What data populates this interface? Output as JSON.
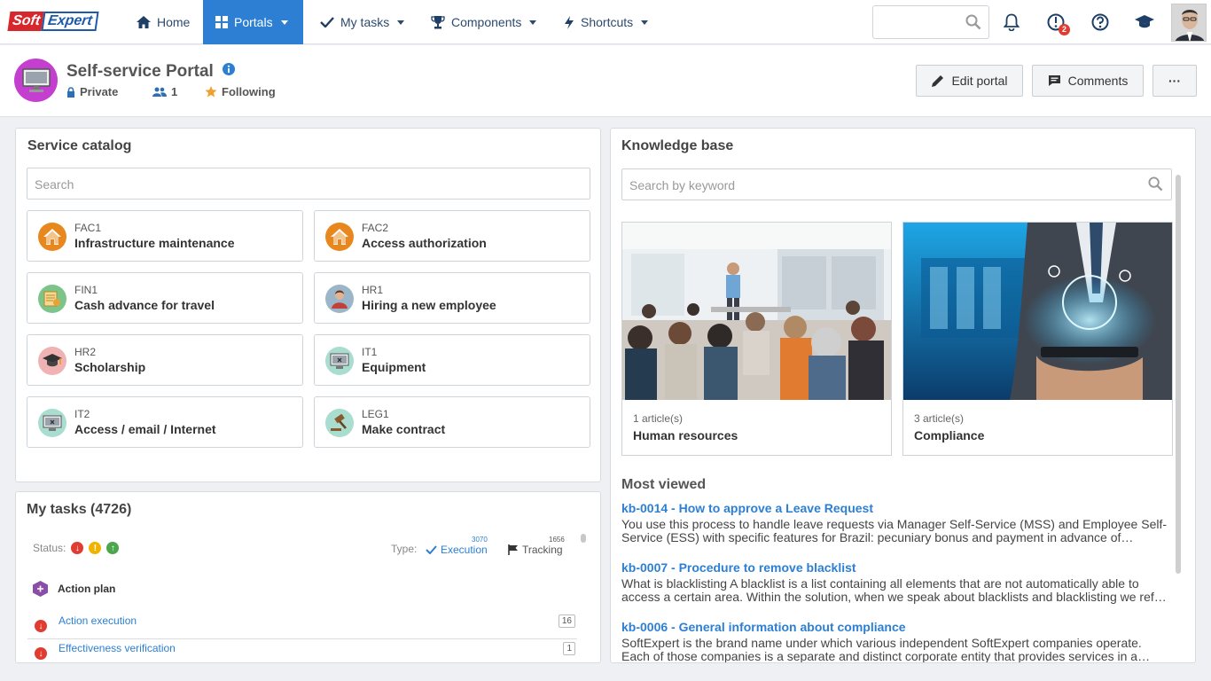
{
  "brand": {
    "part1": "Soft",
    "part2": "Expert"
  },
  "nav": {
    "home": "Home",
    "portals": "Portals",
    "my_tasks": "My tasks",
    "components": "Components",
    "shortcuts": "Shortcuts",
    "notifications_count": "2"
  },
  "portal": {
    "title": "Self-service Portal",
    "privacy": "Private",
    "members": "1",
    "following": "Following",
    "edit_label": "Edit portal",
    "comments_label": "Comments",
    "more_label": "···"
  },
  "catalog": {
    "title": "Service catalog",
    "search_placeholder": "Search",
    "items": [
      {
        "code": "FAC1",
        "name": "Infrastructure maintenance",
        "icon": "house-icon",
        "color": "#e8871e"
      },
      {
        "code": "FAC2",
        "name": "Access authorization",
        "icon": "house-icon",
        "color": "#e8871e"
      },
      {
        "code": "FIN1",
        "name": "Cash advance for travel",
        "icon": "money-icon",
        "color": "#7cc48a"
      },
      {
        "code": "HR1",
        "name": "Hiring a new employee",
        "icon": "person-icon",
        "color": "#9bb6c9"
      },
      {
        "code": "HR2",
        "name": "Scholarship",
        "icon": "graduation-cap-icon",
        "color": "#f0b2b2"
      },
      {
        "code": "IT1",
        "name": "Equipment",
        "icon": "monitor-icon",
        "color": "#a8ddd0"
      },
      {
        "code": "IT2",
        "name": "Access / email / Internet",
        "icon": "monitor-icon",
        "color": "#a8ddd0"
      },
      {
        "code": "LEG1",
        "name": "Make contract",
        "icon": "gavel-icon",
        "color": "#a8ddd0"
      }
    ]
  },
  "tasks": {
    "title": "My tasks (4726)",
    "status_label": "Status:",
    "type_label": "Type:",
    "execution_label": "Execution",
    "execution_count": "3070",
    "tracking_label": "Tracking",
    "tracking_count": "1656",
    "group_label": "Action plan",
    "rows": [
      {
        "label": "Action execution",
        "count": "16"
      },
      {
        "label": "Effectiveness verification",
        "count": "1"
      }
    ]
  },
  "kb": {
    "title": "Knowledge base",
    "search_placeholder": "Search by keyword",
    "tiles": [
      {
        "count": "1 article(s)",
        "name": "Human resources"
      },
      {
        "count": "3 article(s)",
        "name": "Compliance"
      }
    ],
    "most_viewed_title": "Most viewed",
    "articles": [
      {
        "title": "kb-0014 - How to approve a Leave Request",
        "desc": "You use this process to handle leave requests via Manager Self-Service (MSS) and Employee Self-Service (ESS) with specific features for Brazil: pecuniary bonus and payment in advance of…"
      },
      {
        "title": "kb-0007 - Procedure to remove blacklist",
        "desc": "What is blacklisting A blacklist is a list containing all elements that are not automatically able to access a certain area. Within the solution, when we speak about blacklists and blacklisting we ref…"
      },
      {
        "title": "kb-0006 - General information about compliance",
        "desc": "SoftExpert is the brand name under which various independent SoftExpert companies operate. Each of those companies is a separate and distinct corporate entity that provides services in a…"
      }
    ]
  }
}
